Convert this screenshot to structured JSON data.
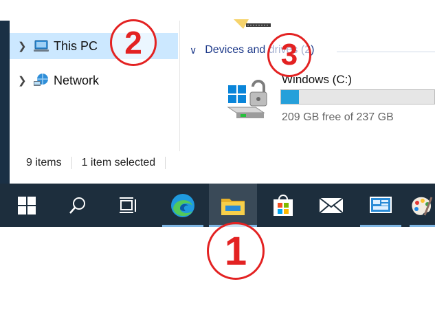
{
  "nav": {
    "items": [
      {
        "label": "This PC",
        "selected": true
      },
      {
        "label": "Network",
        "selected": false
      }
    ]
  },
  "devices": {
    "group_title": "Devices and drives (2)",
    "drive": {
      "name": "Windows (C:)",
      "space_text": "209 GB free of 237 GB",
      "used_fraction": 0.118
    }
  },
  "status": {
    "items_count": "9 items",
    "selection": "1 item selected"
  },
  "taskbar": {
    "buttons": [
      {
        "icon": "windows-start-icon"
      },
      {
        "icon": "search-icon"
      },
      {
        "icon": "task-view-icon"
      },
      {
        "icon": "edge-icon"
      },
      {
        "icon": "file-explorer-icon",
        "active": true
      },
      {
        "icon": "microsoft-store-icon"
      },
      {
        "icon": "mail-icon"
      },
      {
        "icon": "control-panel-icon"
      },
      {
        "icon": "paint-icon"
      }
    ]
  },
  "annotations": {
    "one": "1",
    "two": "2",
    "three": "3"
  },
  "colors": {
    "taskbar": "#1d2e3d",
    "selection": "#cce8ff",
    "accent": "#26a0da",
    "annotation": "#e32222",
    "group_header": "#1e3a8a"
  }
}
